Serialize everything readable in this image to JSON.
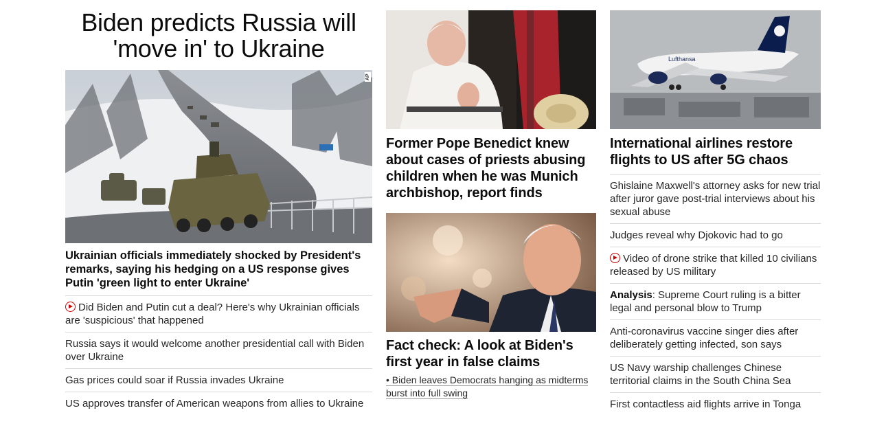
{
  "left": {
    "banner_line1": "Biden predicts Russia will",
    "banner_line2": "'move in' to Ukraine",
    "image_credit": "AP",
    "lead": "Ukrainian officials immediately shocked by President's remarks, saying his hedging on a US response gives Putin 'green light to enter Ukraine'",
    "stories": [
      "Did Biden and Putin cut a deal? Here's why Ukrainian officials are 'suspicious' that happened",
      "Russia says it would welcome another presidential call with Biden over Ukraine",
      "Gas prices could soar if Russia invades Ukraine",
      "US approves transfer of American weapons from allies to Ukraine"
    ]
  },
  "middle": {
    "pope_headline": "Former Pope Benedict knew about cases of priests abusing children when he was Munich archbishop, report finds",
    "factcheck_headline": "Fact check: A look at Biden's first year in false claims",
    "factcheck_sub": "• Biden leaves Democrats hanging as midterms burst into full swing"
  },
  "right": {
    "airline_headline": "International airlines restore flights to US after 5G chaos",
    "stories": [
      "Ghislaine Maxwell's attorney asks for new trial after juror gave post-trial interviews about his sexual abuse",
      "Judges reveal why Djokovic had to go",
      "Video of drone strike that killed 10 civilians released by US military",
      "Supreme Court ruling is a bitter legal and personal blow to Trump",
      "Anti-coronavirus vaccine singer dies after deliberately getting infected, son says",
      "US Navy warship challenges Chinese territorial claims in the South China Sea",
      "First contactless aid flights arrive in Tonga"
    ],
    "analysis_prefix": "Analysis",
    "analysis_sep": ": ",
    "plane_livery": "Lufthansa"
  },
  "icons": {
    "play": "video-play-icon"
  },
  "colors": {
    "accent_red": "#cc0000",
    "divider": "#d9d9d9"
  }
}
